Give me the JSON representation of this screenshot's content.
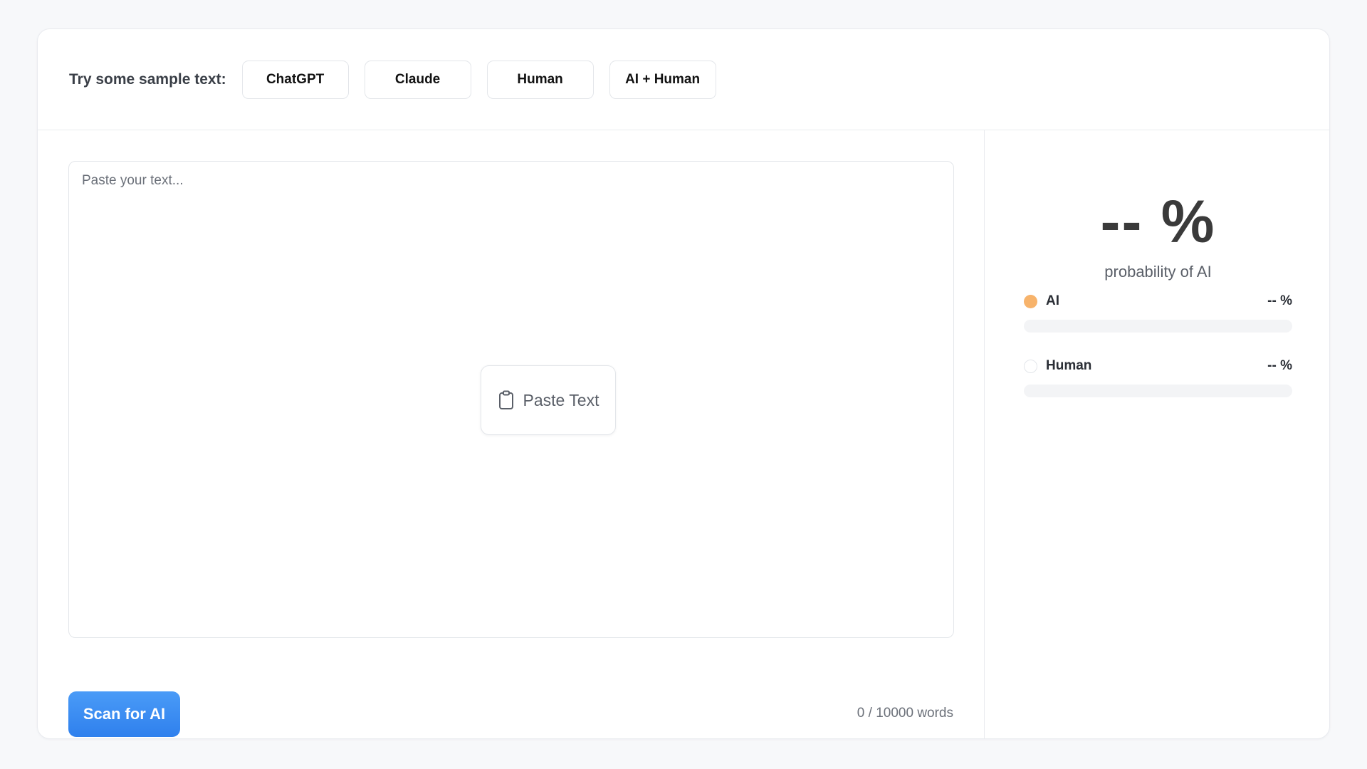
{
  "samples": {
    "label": "Try some sample text:",
    "buttons": [
      "ChatGPT",
      "Claude",
      "Human",
      "AI + Human"
    ]
  },
  "editor": {
    "placeholder": "Paste your text...",
    "paste_label": "Paste Text",
    "paste_icon": "clipboard-icon",
    "scan_label": "Scan for AI",
    "word_count": "0 / 10000 words"
  },
  "result": {
    "probability": "-- %",
    "caption": "probability of AI",
    "metrics": [
      {
        "name": "AI",
        "value": "-- %",
        "color": "#f7b36b"
      },
      {
        "name": "Human",
        "value": "-- %",
        "color": "#ffffff"
      }
    ]
  },
  "colors": {
    "accent": "#2f80ed",
    "ai": "#f7b36b"
  }
}
